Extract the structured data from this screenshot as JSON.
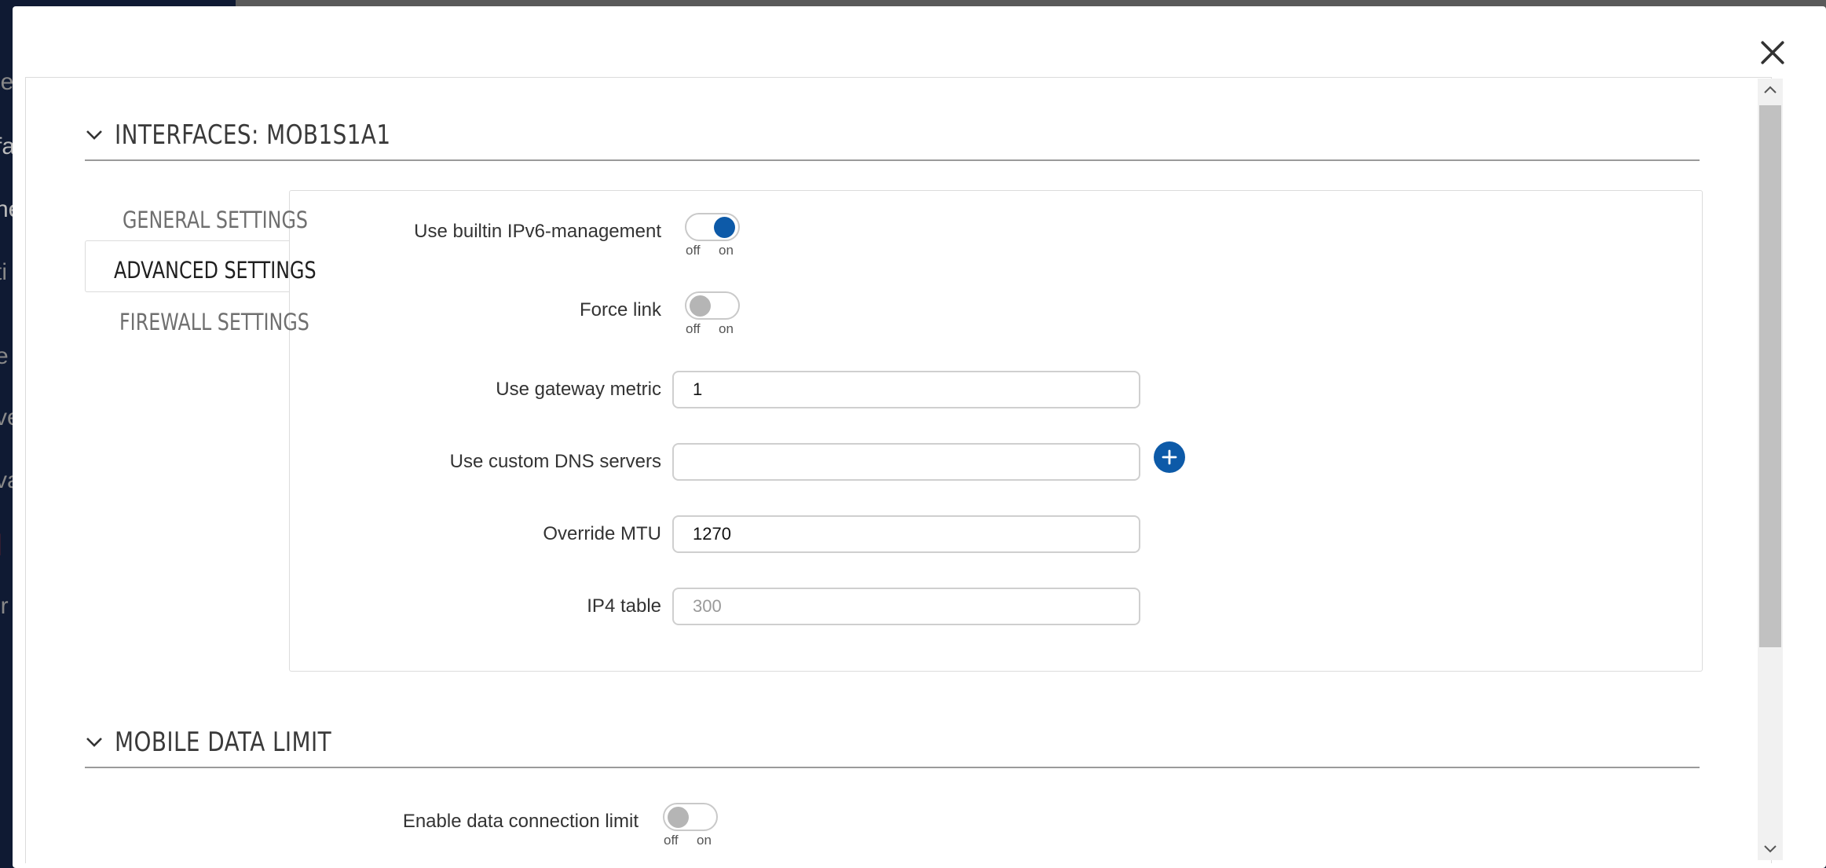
{
  "modal": {
    "title": "INTERFACES: MOB1S1A1",
    "close_icon": "close-icon"
  },
  "tabs": [
    {
      "label": "GENERAL SETTINGS",
      "active": false
    },
    {
      "label": "ADVANCED SETTINGS",
      "active": true
    },
    {
      "label": "FIREWALL SETTINGS",
      "active": false
    }
  ],
  "fields": {
    "ipv6": {
      "label": "Use builtin IPv6-management",
      "state": "on"
    },
    "force_link": {
      "label": "Force link",
      "state": "off"
    },
    "gateway_metric": {
      "label": "Use gateway metric",
      "value": "1"
    },
    "dns": {
      "label": "Use custom DNS servers",
      "value": ""
    },
    "mtu": {
      "label": "Override MTU",
      "value": "1270"
    },
    "ip4_table": {
      "label": "IP4 table",
      "value": "",
      "placeholder": "300"
    }
  },
  "toggle_caps": {
    "off": "off",
    "on": "on"
  },
  "mobile_section": {
    "title": "MOBILE DATA LIMIT",
    "enable_limit": {
      "label": "Enable data connection limit",
      "state": "off"
    }
  },
  "colors": {
    "accent": "#0d5aa8",
    "toggle_off": "#b5b5b5",
    "backdrop": "#0f1a33"
  }
}
